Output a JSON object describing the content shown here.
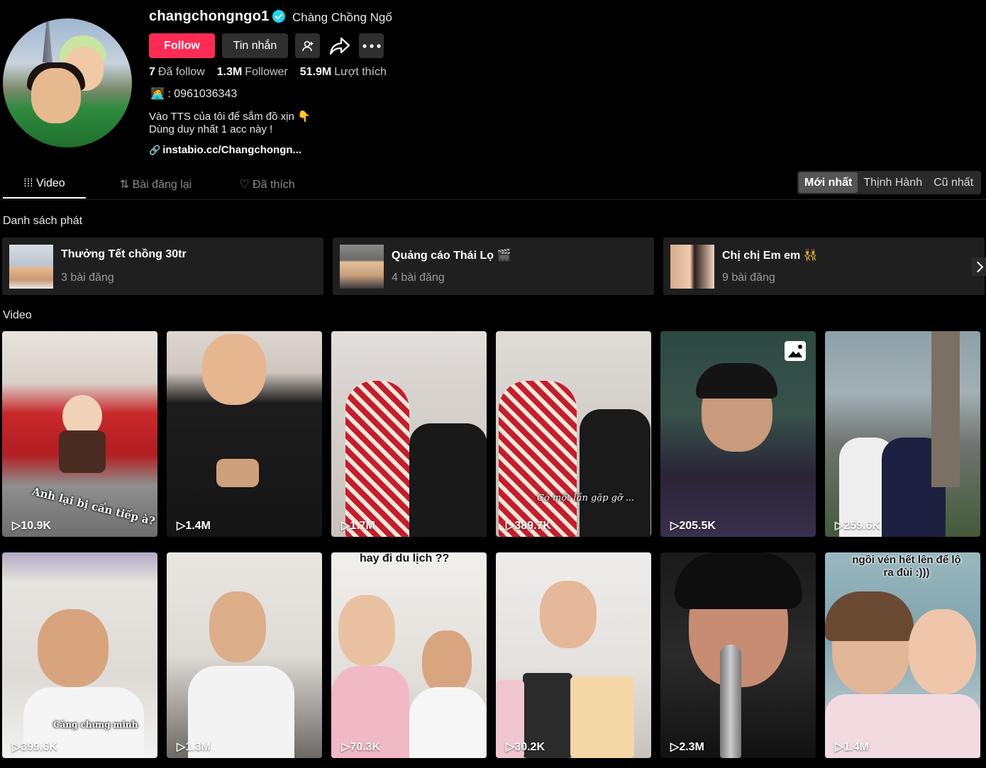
{
  "profile": {
    "username": "changchongngo1",
    "nickname": "Chàng Chồng Ngố",
    "follow_label": "Follow",
    "message_label": "Tin nhắn",
    "stats": {
      "following_count": "7",
      "following_label": "Đã follow",
      "followers_count": "1.3M",
      "followers_label": "Follower",
      "likes_count": "51.9M",
      "likes_label": "Lượt thích"
    },
    "phone_emoji": "🧑‍💻",
    "phone": ": 0961036343",
    "bio_line1": "Vào TTS của tôi để sắm đồ xịn 👇",
    "bio_line2": "Dùng duy nhất 1 acc này !",
    "link": "instabio.cc/Changchongn..."
  },
  "tabs": {
    "video": "Video",
    "reposts": "Bài đăng lại",
    "liked": "Đã thích"
  },
  "sort": {
    "newest": "Mới nhất",
    "popular": "Thịnh Hành",
    "oldest": "Cũ nhất"
  },
  "playlists": {
    "title": "Danh sách phát",
    "items": [
      {
        "name": "Thưởng Tết chồng 30tr",
        "count": "3 bài đăng"
      },
      {
        "name": "Quảng cáo Thái Lọ 🎬",
        "count": "4 bài đăng"
      },
      {
        "name": "Chị chị Em em 👯",
        "count": "9 bài đăng"
      }
    ]
  },
  "videos": {
    "title": "Video",
    "items": [
      {
        "views": "10.9K",
        "caption": "Anh lại bị cẩn tiếp à?"
      },
      {
        "views": "1.4M",
        "caption": ""
      },
      {
        "views": "1.7M",
        "caption": ""
      },
      {
        "views": "389.7K",
        "caption": "Có một lần gặp gỡ ..."
      },
      {
        "views": "205.5K",
        "caption": ""
      },
      {
        "views": "259.6K",
        "caption": ""
      },
      {
        "views": "399.6K",
        "caption": "Căng chưng minh"
      },
      {
        "views": "1.3M",
        "caption": ""
      },
      {
        "views": "70.3K",
        "caption": "hay đi du lịch ??"
      },
      {
        "views": "30.2K",
        "caption": ""
      },
      {
        "views": "2.3M",
        "caption": ""
      },
      {
        "views": "1.4M",
        "caption": "ngồi vén hết lên để lộ ra đùi :)))"
      }
    ]
  }
}
